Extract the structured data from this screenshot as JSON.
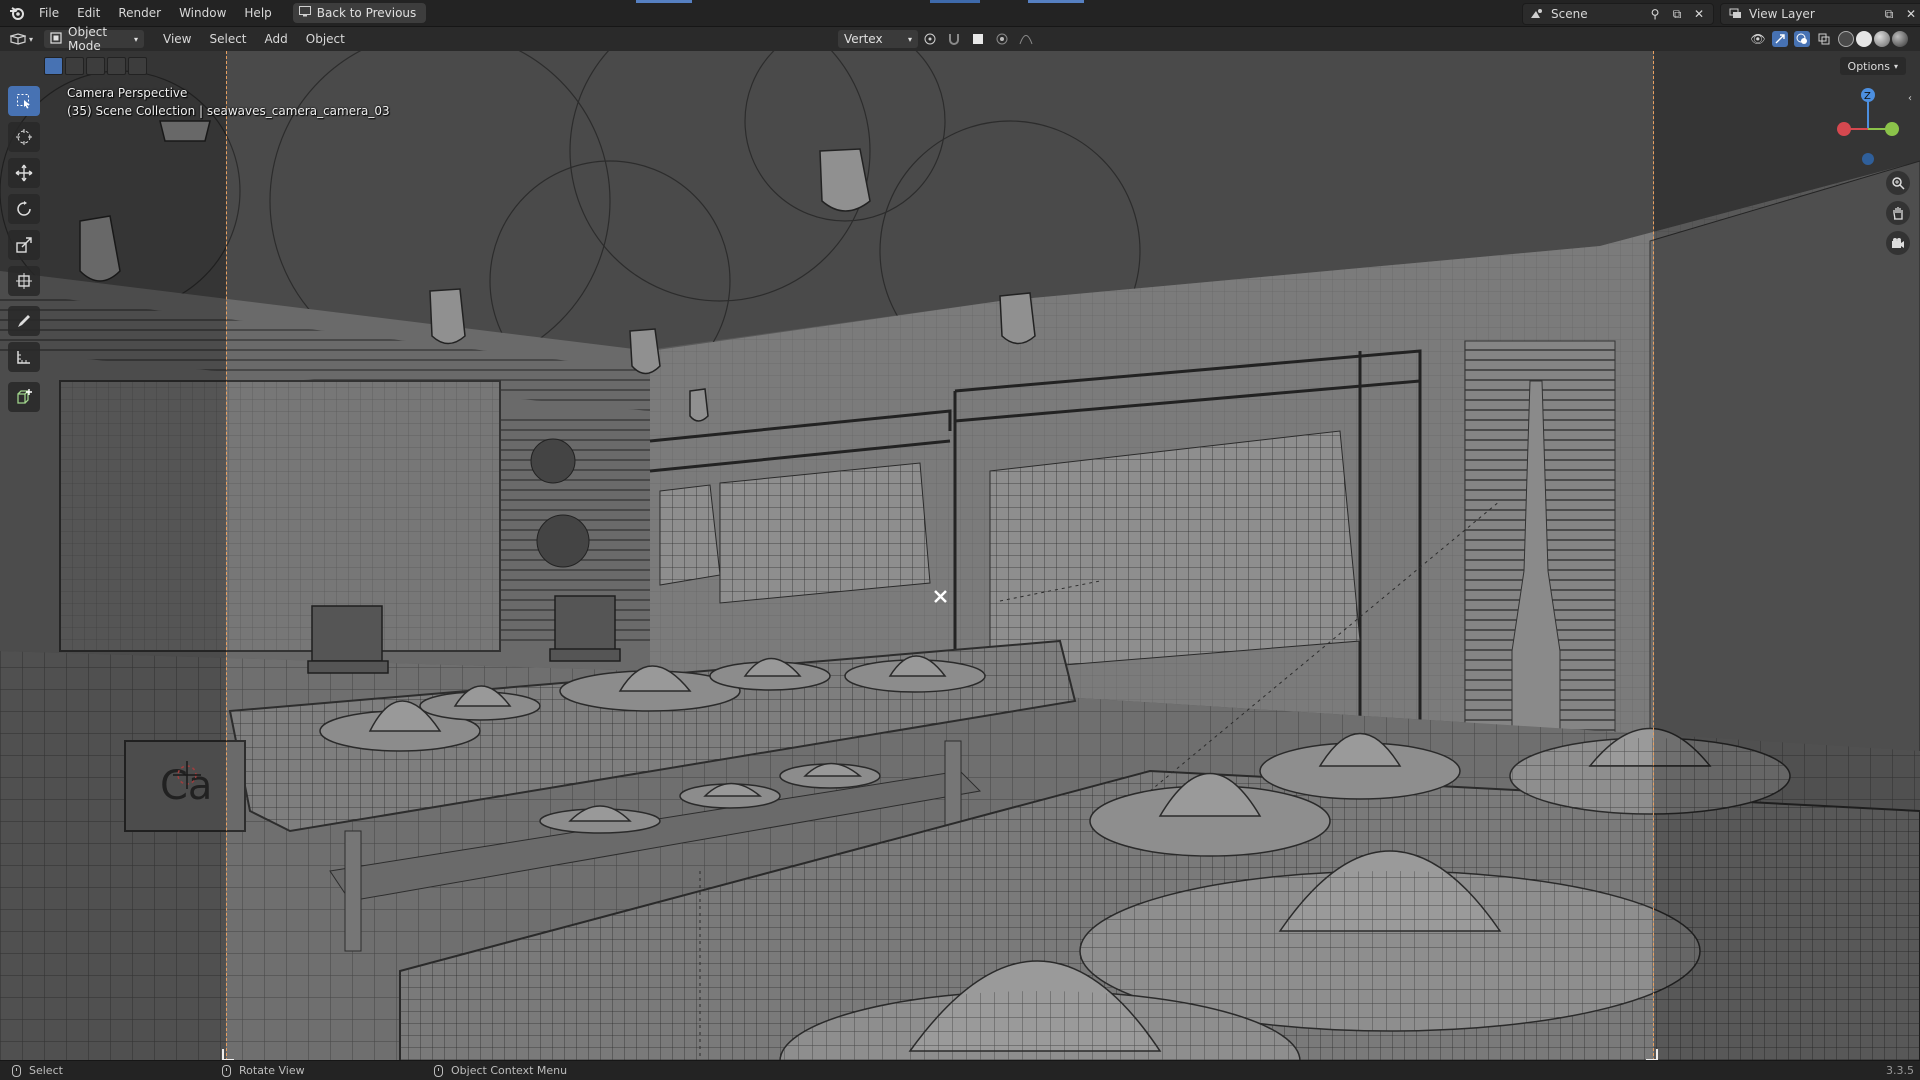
{
  "topbar": {
    "menus": [
      "File",
      "Edit",
      "Render",
      "Window",
      "Help"
    ],
    "back_label": "Back to Previous",
    "scene_label": "Scene",
    "view_layer_label": "View Layer"
  },
  "header": {
    "mode_label": "Object Mode",
    "menus": [
      "View",
      "Select",
      "Add",
      "Object"
    ],
    "snap_label": "Vertex",
    "options_label": "Options"
  },
  "viewport": {
    "perspective_label": "Camera Perspective",
    "collection_label": "(35) Scene Collection | seawaves_camera_camera_03",
    "sign_text": "Ca",
    "gizmo_axes": {
      "x": "X",
      "y": "Y",
      "z": "Z"
    }
  },
  "statusbar": {
    "select_label": "Select",
    "rotate_label": "Rotate View",
    "context_label": "Object Context Menu",
    "version": "3.3.5"
  },
  "colors": {
    "accent": "#4772b3",
    "x_axis": "#d5484f",
    "y_axis": "#8bc34a",
    "z_axis": "#4c8fe0",
    "camera_frame": "#e8a060"
  }
}
